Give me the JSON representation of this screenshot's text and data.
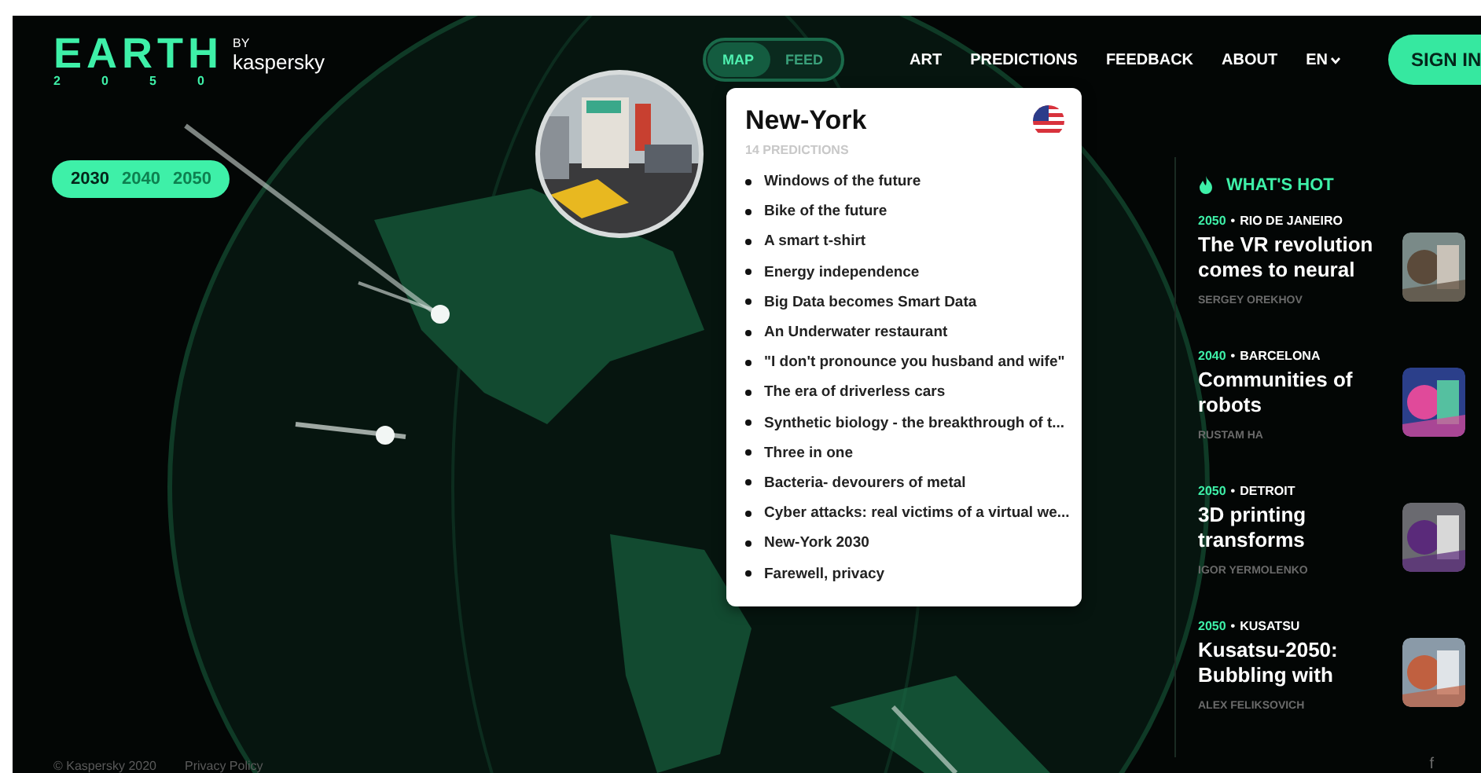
{
  "logo": {
    "word": "EARTH",
    "year_digits": [
      "2",
      "0",
      "5",
      "0"
    ],
    "by": "BY",
    "brand": "kaspersky"
  },
  "years": [
    {
      "label": "2030",
      "selected": true
    },
    {
      "label": "2040",
      "selected": false
    },
    {
      "label": "2050",
      "selected": false
    }
  ],
  "view_toggle": [
    {
      "label": "MAP",
      "selected": true
    },
    {
      "label": "FEED",
      "selected": false
    }
  ],
  "nav": [
    "ART",
    "PREDICTIONS",
    "FEEDBACK",
    "ABOUT"
  ],
  "language": "EN",
  "sign_in": "SIGN IN",
  "city_popup": {
    "title": "New-York",
    "count": "14 PREDICTIONS",
    "predictions": [
      "Windows of the future",
      "Bike of the future",
      "A smart t-shirt",
      "Energy independence",
      "Big Data becomes Smart Data",
      "An Underwater restaurant",
      "\"I don't pronounce you husband and wife\"",
      "The era of driverless cars",
      "Synthetic biology - the breakthrough of t...",
      "Three in one",
      "Bacteria- devourers of metal",
      "Cyber attacks: real victims of a virtual we...",
      "New-York 2030",
      "Farewell, privacy"
    ]
  },
  "whats_hot": {
    "title": "WHAT'S HOT",
    "articles": [
      {
        "year": "2050",
        "sep": "•",
        "place": "RIO DE JANEIRO",
        "title": "The VR revolution comes to neural",
        "author": "SERGEY OREKHOV"
      },
      {
        "year": "2040",
        "sep": "•",
        "place": "BARCELONA",
        "title": "Communities of robots",
        "author": "RUSTAM HA"
      },
      {
        "year": "2050",
        "sep": "•",
        "place": "DETROIT",
        "title": "3D printing transforms",
        "author": "IGOR YERMOLENKO"
      },
      {
        "year": "2050",
        "sep": "•",
        "place": "KUSATSU",
        "title": "Kusatsu-2050: Bubbling with",
        "author": "ALEX FELIKSOVICH"
      }
    ]
  },
  "footer": {
    "copyright": "© Kaspersky 2020",
    "links": [
      "Privacy Policy"
    ],
    "social": "f"
  }
}
